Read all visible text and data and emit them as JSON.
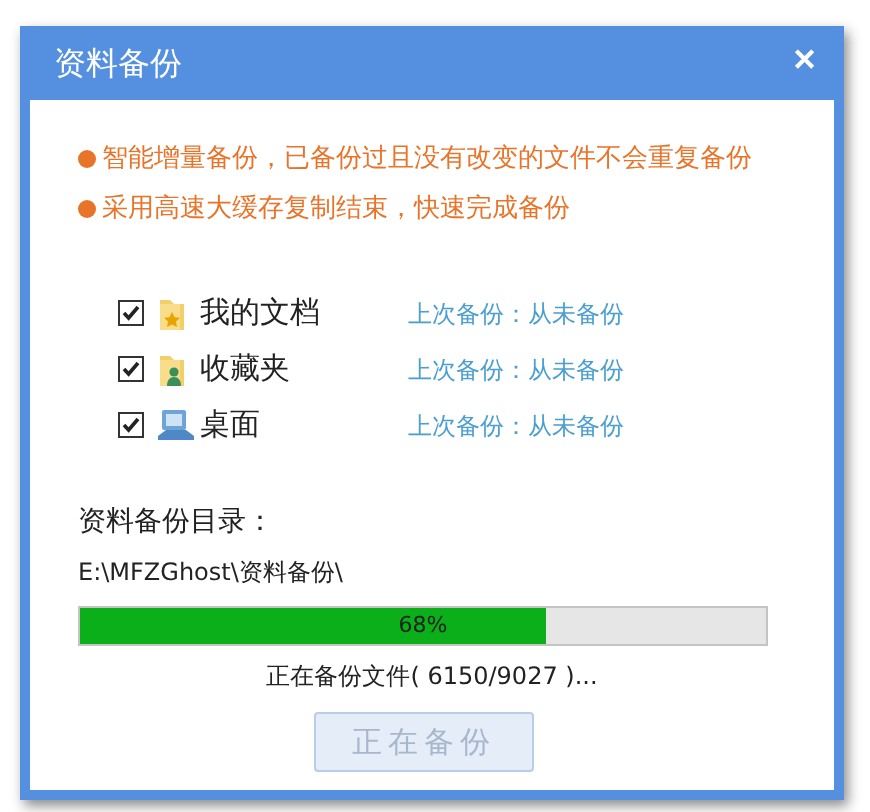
{
  "window": {
    "title": "资料备份",
    "close": "✕"
  },
  "notes": [
    "智能增量备份，已备份过且没有改变的文件不会重复备份",
    "采用高速大缓存复制结束，快速完成备份"
  ],
  "items": [
    {
      "label": "我的文档",
      "kind": "documents",
      "checked": true,
      "last_backup": "上次备份：从未备份"
    },
    {
      "label": "收藏夹",
      "kind": "favorites",
      "checked": true,
      "last_backup": "上次备份：从未备份"
    },
    {
      "label": "桌面",
      "kind": "desktop",
      "checked": true,
      "last_backup": "上次备份：从未备份"
    }
  ],
  "directory": {
    "label": "资料备份目录：",
    "path": "E:\\MFZGhost\\资料备份\\"
  },
  "progress": {
    "level": 0.68,
    "reading": "68%"
  },
  "status": "正在备份文件( 6150/9027 )...",
  "button": {
    "label": "正在备份",
    "disabled": true
  }
}
